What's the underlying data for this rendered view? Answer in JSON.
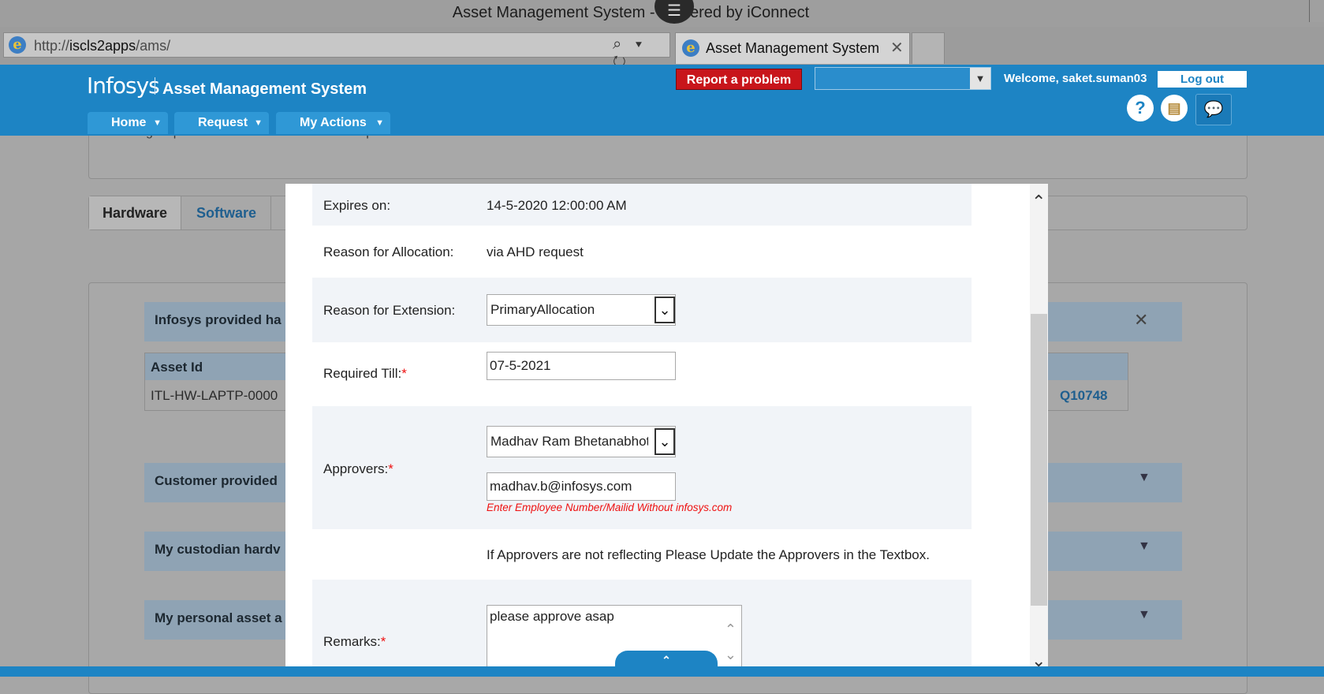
{
  "window": {
    "title": "Asset Management System - Powered by iConnect",
    "menu_glyph": "☰"
  },
  "browser": {
    "url_prefix": "http://",
    "url_host": "iscls2apps",
    "url_path": "/ams/",
    "tools": "⌕ ▾ ↻",
    "tab_title": "Asset Management System",
    "tab_close": "✕",
    "ie_glyph": "e"
  },
  "header": {
    "logo": "Infosys",
    "app_title": "Asset Management System",
    "nav": [
      {
        "label": "Home"
      },
      {
        "label": "Request"
      },
      {
        "label": "My Actions"
      }
    ],
    "report_button": "Report a problem",
    "welcome": "Welcome, saket.suman03",
    "logout": "Log out",
    "help_glyph": "?",
    "folder_glyph": "▤",
    "chat_glyph": "💬"
  },
  "background": {
    "info_text": "To change it please select the Asset id from drop Down and Click on Select button.",
    "tabs": [
      "Hardware",
      "Software"
    ],
    "panel_infosys": "Infosys provided ha",
    "table_header": "Asset Id",
    "table_asset_id": "ITL-HW-LAPTP-0000",
    "table_right_value": "Q10748",
    "panel_customer": "Customer provided",
    "panel_custodian": "My custodian hardv",
    "panel_personal": "My personal asset a"
  },
  "modal": {
    "expires_label": "Expires on:",
    "expires_value": "14-5-2020 12:00:00 AM",
    "reason_alloc_label": "Reason for Allocation:",
    "reason_alloc_value": "via AHD request",
    "reason_ext_label": "Reason for Extension:",
    "reason_ext_value": "PrimaryAllocation",
    "required_till_label": "Required Till:",
    "required_till_value": "07-5-2021",
    "approvers_label": "Approvers:",
    "approver_selected": "Madhav Ram Bhetanabhotla",
    "approver_email": "madhav.b@infosys.com",
    "approver_hint": "Enter Employee Number/Mailid Without infosys.com",
    "approver_note": "If Approvers are not reflecting Please Update the Approvers in the Textbox.",
    "remarks_label": "Remarks:",
    "remarks_value": "please approve asap",
    "required_mark": "*"
  }
}
